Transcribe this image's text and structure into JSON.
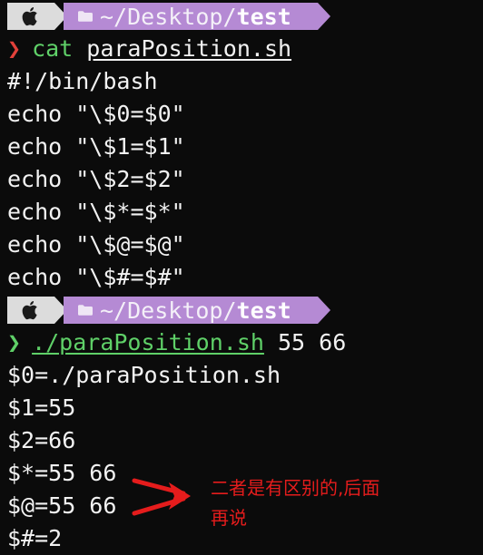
{
  "prompt": {
    "apple_icon": "apple-logo-icon",
    "folder_icon": "folder-icon",
    "path_prefix": "~/Desktop/",
    "path_dir": "test"
  },
  "block1": {
    "chevron": "❯",
    "command": "cat",
    "argument": "paraPosition.sh",
    "output": [
      "#!/bin/bash",
      "echo \"\\$0=$0\"",
      "echo \"\\$1=$1\"",
      "echo \"\\$2=$2\"",
      "echo \"\\$*=$*\"",
      "echo \"\\$@=$@\"",
      "echo \"\\$#=$#\""
    ]
  },
  "block2": {
    "chevron": "❯",
    "command": "./paraPosition.sh",
    "args": " 55 66",
    "output": [
      "$0=./paraPosition.sh",
      "$1=55",
      "$2=66",
      "$*=55 66",
      "$@=55 66",
      "$#=2"
    ]
  },
  "annotation": {
    "line1": "二者是有区别的,后面",
    "line2": "再说",
    "color": "#e51c1c"
  },
  "colors": {
    "path_segment": "#b58ad4",
    "apple_segment": "#dcdcdc",
    "chevron_error": "#e2413a",
    "chevron_ok": "#5fd068"
  }
}
